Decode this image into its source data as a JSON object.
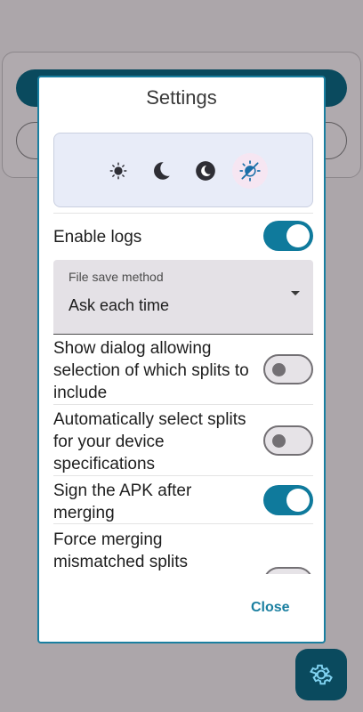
{
  "dialog": {
    "title": "Settings",
    "theme_options": [
      "light-mode-icon",
      "dark-mode-icon",
      "black-theme-icon",
      "system-theme-icon"
    ],
    "theme_selected": "system-theme-icon",
    "settings": [
      {
        "label": "Enable logs",
        "on": true
      },
      {
        "label": "Show dialog allowing selection of which splits to include",
        "on": false
      },
      {
        "label": "Automatically select splits for your device specifications",
        "on": false
      },
      {
        "label": "Sign the APK after merging",
        "on": true
      },
      {
        "label": "Force merging mismatched splits",
        "on": false
      }
    ],
    "file_save": {
      "label": "File save method",
      "value": "Ask each time"
    },
    "close_label": "Close"
  },
  "colors": {
    "accent": "#0f7a9c",
    "dialog_border": "#1a7fa0",
    "fab": "#0a4a5e"
  }
}
